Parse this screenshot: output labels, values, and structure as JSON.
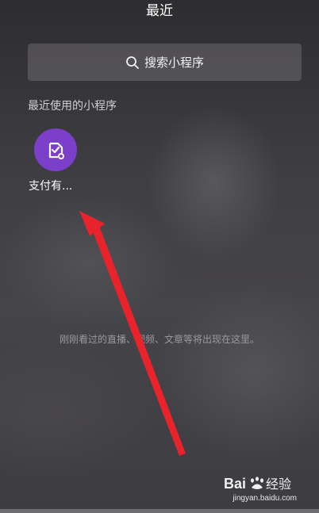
{
  "header": {
    "title": "最近"
  },
  "search": {
    "placeholder": "搜索小程序",
    "icon": "search-icon"
  },
  "recent_section": {
    "title": "最近使用的小程序",
    "apps": [
      {
        "label": "支付有...",
        "icon": "payment-document-check-icon",
        "color": "#7b3fc9"
      }
    ]
  },
  "empty_state": {
    "text": "刚刚看过的直播、视频、文章等将出现在这里。"
  },
  "watermark": {
    "brand": "Bai经验",
    "url": "jingyan.baidu.com"
  },
  "colors": {
    "annotation_arrow": "#e8232b",
    "text_primary": "#ffffff",
    "text_secondary": "#9a999d"
  }
}
